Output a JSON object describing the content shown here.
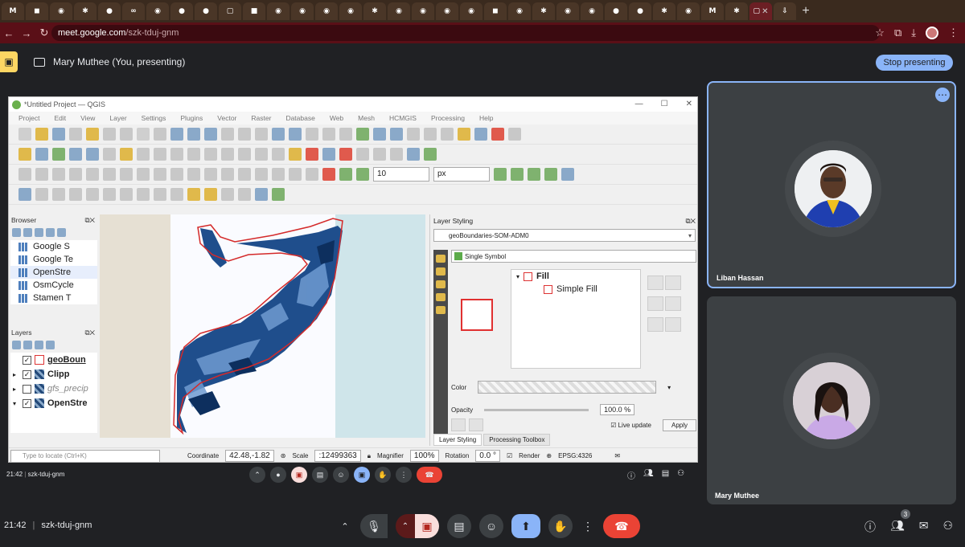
{
  "browser": {
    "url_host": "meet.google.com",
    "url_path": "/szk-tduj-gnm"
  },
  "presenting": {
    "label": "Mary Muthee (You, presenting)",
    "stop_label": "Stop presenting"
  },
  "qgis": {
    "title": "*Untitled Project — QGIS",
    "menu": [
      "Project",
      "Edit",
      "View",
      "Layer",
      "Settings",
      "Plugins",
      "Vector",
      "Raster",
      "Database",
      "Web",
      "Mesh",
      "HCMGIS",
      "Processing",
      "Help"
    ],
    "snap_value": "10",
    "snap_unit": "px",
    "browser_title": "Browser",
    "browser_items": [
      "Google S",
      "Google Te",
      "OpenStre",
      "OsmCycle",
      "Stamen T"
    ],
    "layers_title": "Layers",
    "layers": [
      {
        "name": "geoBoun",
        "checked": "✓"
      },
      {
        "name": "Clipp",
        "checked": "✓"
      },
      {
        "name": "gfs_precip",
        "checked": ""
      },
      {
        "name": "OpenStre",
        "checked": "✓"
      }
    ],
    "styling_title": "Layer Styling",
    "styling_layer": "geoBoundaries-SOM-ADM0",
    "renderer": "Single Symbol",
    "symbol_tree": [
      "Fill",
      "Simple Fill"
    ],
    "color_label": "Color",
    "opacity_label": "Opacity",
    "opacity_value": "100.0 %",
    "live_update_label": "Live update",
    "apply_label": "Apply",
    "tabs": [
      "Layer Styling",
      "Processing Toolbox"
    ],
    "status": {
      "locate_placeholder": "Type to locate (Ctrl+K)",
      "coordinate_label": "Coordinate",
      "coordinate_value": "42.48,-1.82",
      "scale_label": "Scale",
      "scale_value": ":12499363",
      "magnifier_label": "Magnifier",
      "magnifier_value": "100%",
      "rotation_label": "Rotation",
      "rotation_value": "0.0 °",
      "render_label": "Render",
      "crs": "EPSG:4326"
    }
  },
  "inner_meeting": {
    "time": "21:42",
    "code": "szk-tduj-gnm"
  },
  "participants": [
    {
      "name": "Liban Hassan"
    },
    {
      "name": "Mary Muthee"
    }
  ],
  "meeting": {
    "time": "21:42",
    "code": "szk-tduj-gnm",
    "people_count": "3"
  }
}
